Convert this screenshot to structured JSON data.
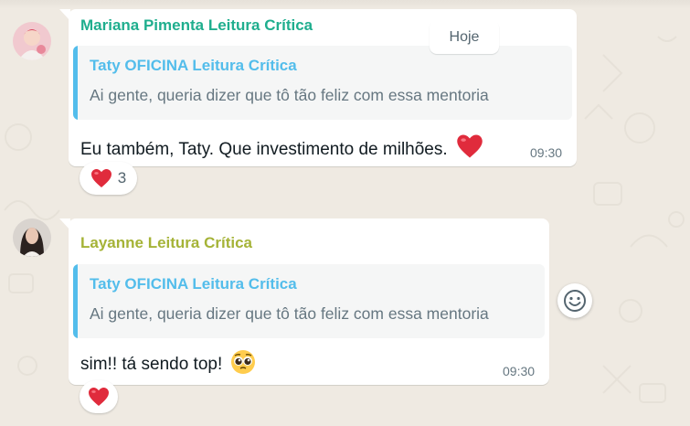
{
  "date_chip": "Hoje",
  "messages": [
    {
      "sender": "Mariana Pimenta Leitura Crítica",
      "sender_color": "#1fae8e",
      "quote": {
        "author": "Taty OFICINA Leitura Crítica",
        "text": "Ai gente, queria dizer que tô tão feliz com essa mentoria"
      },
      "text": "Eu também, Taty. Que investimento de milhões.",
      "emoji": "heart",
      "time": "09:30",
      "reaction": {
        "emoji": "heart",
        "count": "3"
      }
    },
    {
      "sender": "Layanne Leitura Crítica",
      "sender_color": "#a5b337",
      "quote": {
        "author": "Taty OFICINA Leitura Crítica",
        "text": "Ai gente, queria dizer que tô tão feliz com essa mentoria"
      },
      "text": "sim!! tá sendo top!",
      "emoji": "pleading-face",
      "time": "09:30",
      "reaction": {
        "emoji": "heart",
        "count": ""
      }
    }
  ],
  "colors": {
    "background": "#efeae2",
    "quote_bar": "#53bdeb",
    "heart": "#e02b3c"
  },
  "icons": [
    "smile-icon",
    "heart-icon",
    "pleading-face-icon"
  ]
}
